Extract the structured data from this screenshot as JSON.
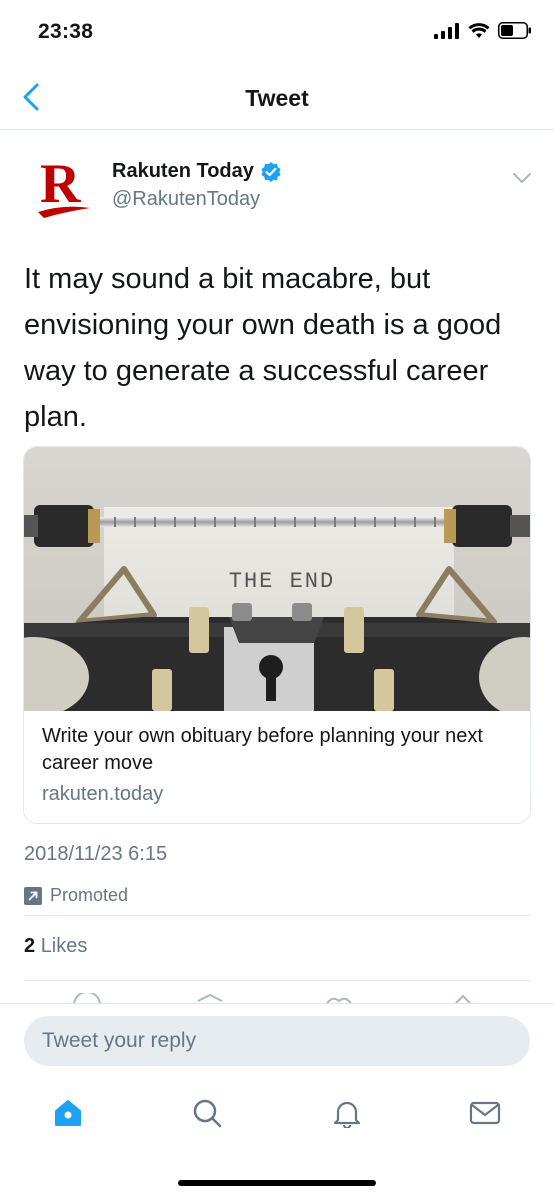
{
  "status_bar": {
    "time": "23:38"
  },
  "nav": {
    "title": "Tweet"
  },
  "author": {
    "name": "Rakuten Today",
    "handle": "@RakutenToday",
    "avatar_letter": "R"
  },
  "tweet": {
    "text": "It may sound a bit macabre, but envisioning your own death is a good way to generate a successful career plan.",
    "timestamp": "2018/11/23 6:15",
    "promoted_label": "Promoted",
    "likes_count": "2",
    "likes_label": "Likes"
  },
  "card": {
    "image_text": "THE END",
    "title": "Write your own obituary before planning your next career move",
    "domain": "rakuten.today"
  },
  "reply": {
    "placeholder": "Tweet your reply"
  },
  "colors": {
    "accent": "#1da1f2",
    "brand_red": "#bf0000",
    "muted": "#657786",
    "border": "#e1e8ed"
  }
}
